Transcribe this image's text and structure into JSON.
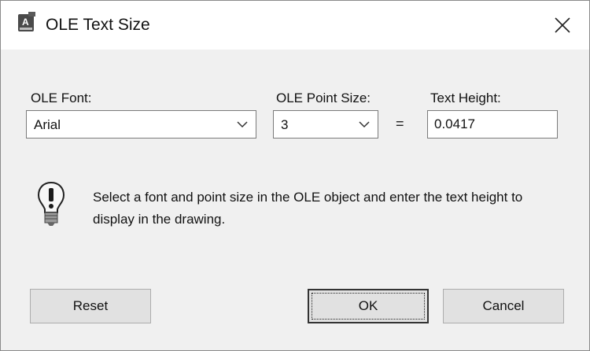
{
  "window": {
    "title": "OLE Text Size",
    "app_icon": "autocad-dwg-icon",
    "close_icon": "close-icon"
  },
  "font": {
    "label": "OLE Font:",
    "value": "Arial"
  },
  "point_size": {
    "label": "OLE Point Size:",
    "value": "3"
  },
  "equals": "=",
  "text_height": {
    "label": "Text Height:",
    "value": "0.0417"
  },
  "info": {
    "icon": "lightbulb-icon",
    "message": "Select a font and point size in the OLE object and enter the text height to display in the drawing."
  },
  "buttons": {
    "reset": "Reset",
    "ok": "OK",
    "cancel": "Cancel"
  }
}
